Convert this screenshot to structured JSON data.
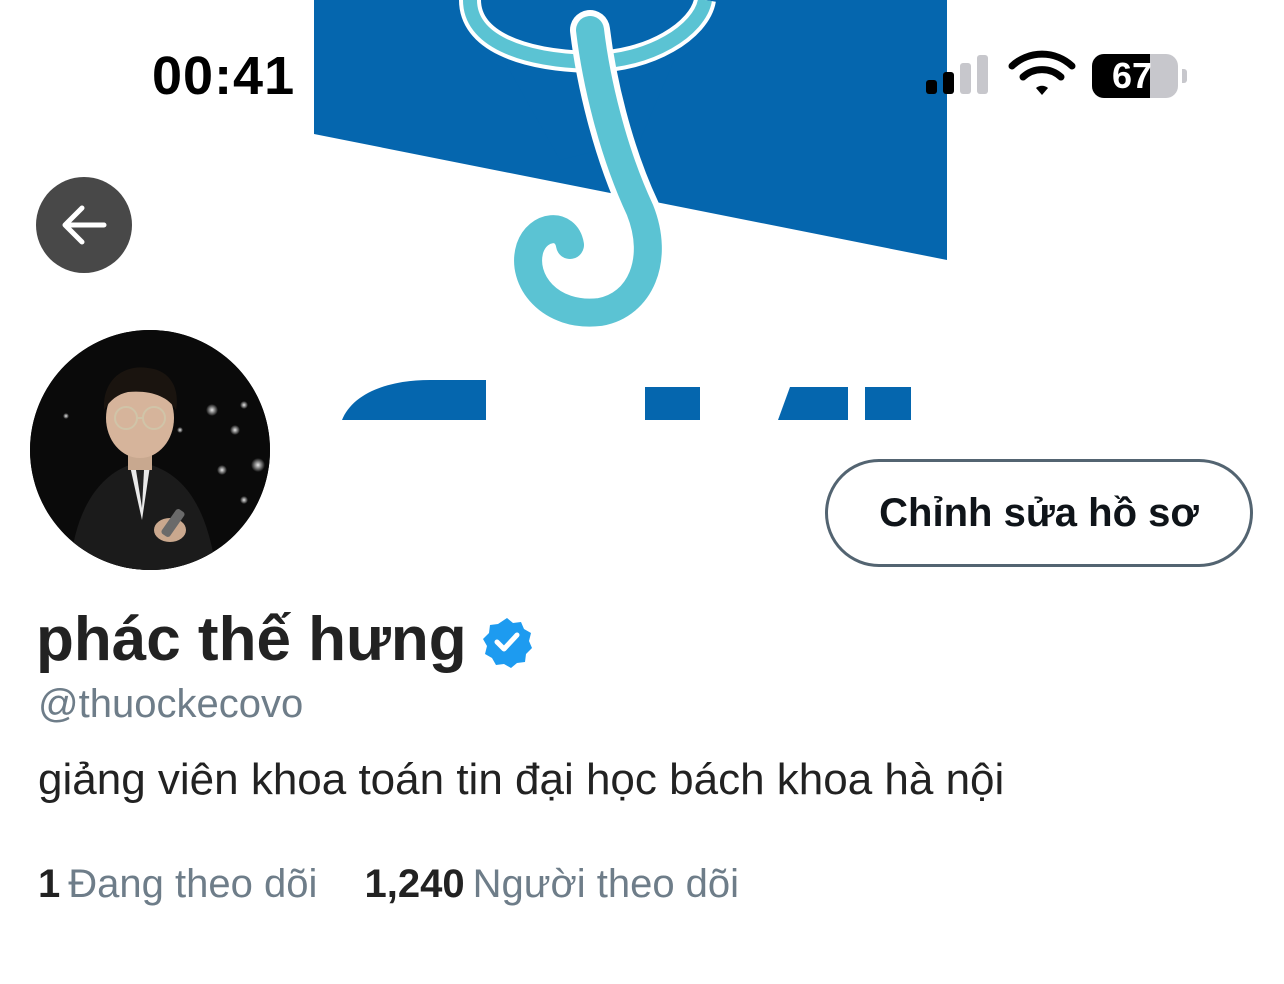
{
  "status_bar": {
    "time": "00:41",
    "battery_percent": "67",
    "battery_level": 0.67,
    "signal_bars": 2,
    "icons": [
      "cellular-signal-icon",
      "wifi-icon",
      "battery-icon"
    ]
  },
  "banner": {
    "description_icon": "banner-logo-image",
    "colors": {
      "dark_blue": "#0566AE",
      "light_blue": "#5BC3D3"
    }
  },
  "profile": {
    "display_name": "phác thế hưng",
    "verified": true,
    "handle": "@thuockecovo",
    "bio": "giảng viên khoa toán tin đại học bách khoa hà nội",
    "edit_button_label": "Chỉnh sửa hồ sơ",
    "stats": {
      "following_count": "1",
      "following_label": "Đang theo dõi",
      "followers_count": "1,240",
      "followers_label": "Người theo dõi"
    }
  },
  "colors": {
    "verified_blue": "#1D9BF0",
    "secondary_text": "#6E7D89",
    "primary_text": "#222222"
  }
}
